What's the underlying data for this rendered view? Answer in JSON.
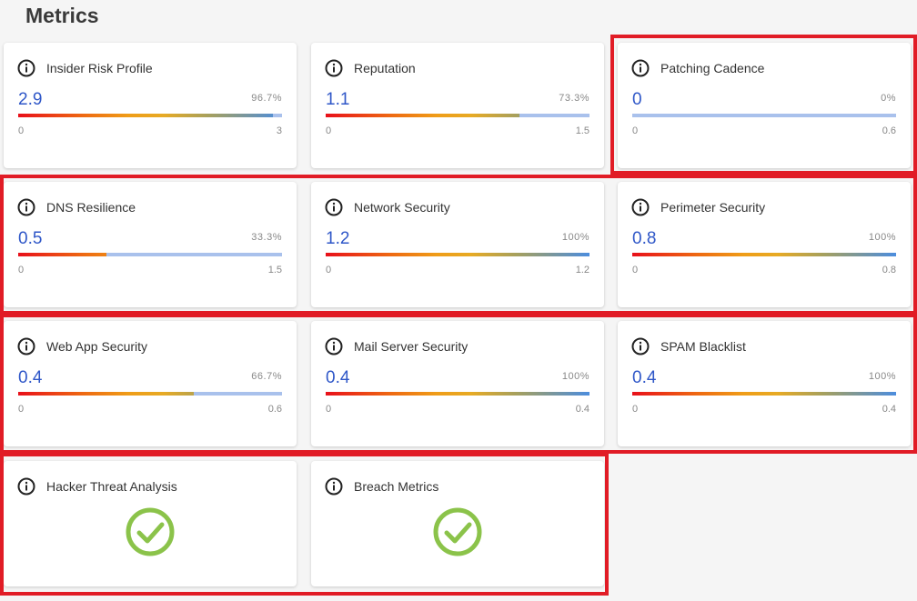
{
  "page": {
    "title": "Metrics"
  },
  "colors": {
    "value_blue": "#2f57c8",
    "track": "#a9c1ec",
    "highlight": "#e11c26",
    "check": "#8bc34a"
  },
  "cards": [
    {
      "title": "Insider Risk Profile",
      "value": "2.9",
      "percent_label": "96.7%",
      "fill_fraction": 0.967,
      "min": "0",
      "max": "3",
      "icon": "info-icon"
    },
    {
      "title": "Reputation",
      "value": "1.1",
      "percent_label": "73.3%",
      "fill_fraction": 0.733,
      "min": "0",
      "max": "1.5",
      "icon": "info-icon"
    },
    {
      "title": "Patching Cadence",
      "value": "0",
      "percent_label": "0%",
      "fill_fraction": 0,
      "min": "0",
      "max": "0.6",
      "icon": "info-icon"
    },
    {
      "title": "DNS Resilience",
      "value": "0.5",
      "percent_label": "33.3%",
      "fill_fraction": 0.333,
      "min": "0",
      "max": "1.5",
      "icon": "info-icon"
    },
    {
      "title": "Network Security",
      "value": "1.2",
      "percent_label": "100%",
      "fill_fraction": 1,
      "min": "0",
      "max": "1.2",
      "icon": "info-icon"
    },
    {
      "title": "Perimeter Security",
      "value": "0.8",
      "percent_label": "100%",
      "fill_fraction": 1,
      "min": "0",
      "max": "0.8",
      "icon": "info-icon"
    },
    {
      "title": "Web App Security",
      "value": "0.4",
      "percent_label": "66.7%",
      "fill_fraction": 0.667,
      "min": "0",
      "max": "0.6",
      "icon": "info-icon"
    },
    {
      "title": "Mail Server Security",
      "value": "0.4",
      "percent_label": "100%",
      "fill_fraction": 1,
      "min": "0",
      "max": "0.4",
      "icon": "info-icon"
    },
    {
      "title": "SPAM Blacklist",
      "value": "0.4",
      "percent_label": "100%",
      "fill_fraction": 1,
      "min": "0",
      "max": "0.4",
      "icon": "info-icon"
    },
    {
      "title": "Hacker Threat Analysis",
      "status": "check",
      "icon": "info-icon",
      "status_icon": "check-circle-icon"
    },
    {
      "title": "Breach Metrics",
      "status": "check",
      "icon": "info-icon",
      "status_icon": "check-circle-icon"
    }
  ]
}
